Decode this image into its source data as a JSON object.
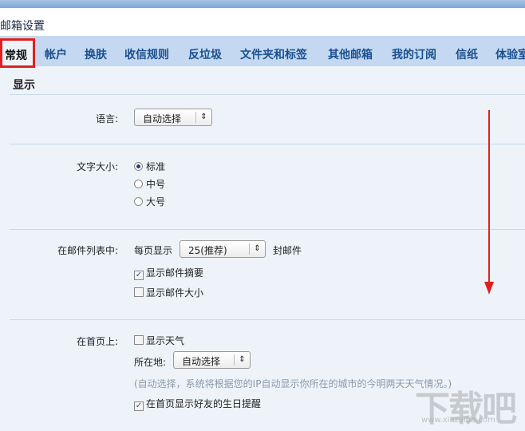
{
  "title": "邮箱设置",
  "tabs": [
    "常规",
    "帐户",
    "换肤",
    "收信规则",
    "反垃圾",
    "文件夹和标签",
    "其他邮箱",
    "我的订阅",
    "信纸",
    "体验室"
  ],
  "section": "显示",
  "language": {
    "label": "语言:",
    "value": "自动选择"
  },
  "font_size": {
    "label": "文字大小:",
    "options": [
      "标准",
      "中号",
      "大号"
    ],
    "selected": "标准"
  },
  "mail_list": {
    "label": "在邮件列表中:",
    "per_page_prefix": "每页显示",
    "per_page_value": "25(推荐)",
    "per_page_suffix": "封邮件",
    "show_summary": "显示邮件摘要",
    "show_summary_checked": true,
    "show_size": "显示邮件大小",
    "show_size_checked": false
  },
  "homepage": {
    "label": "在首页上:",
    "show_weather": "显示天气",
    "show_weather_checked": false,
    "location_label": "所在地:",
    "location_value": "自动选择",
    "hint": "(自动选择，系统将根据您的IP自动显示你所在的城市的今明两天天气情况。)",
    "birthday": "在首页显示好友的生日提醒",
    "birthday_checked": true
  },
  "watermark": {
    "text": "下载吧",
    "url": "www.xiazaiba.com"
  },
  "colors": {
    "accent": "#1b4f8f",
    "highlight": "#e02020"
  }
}
